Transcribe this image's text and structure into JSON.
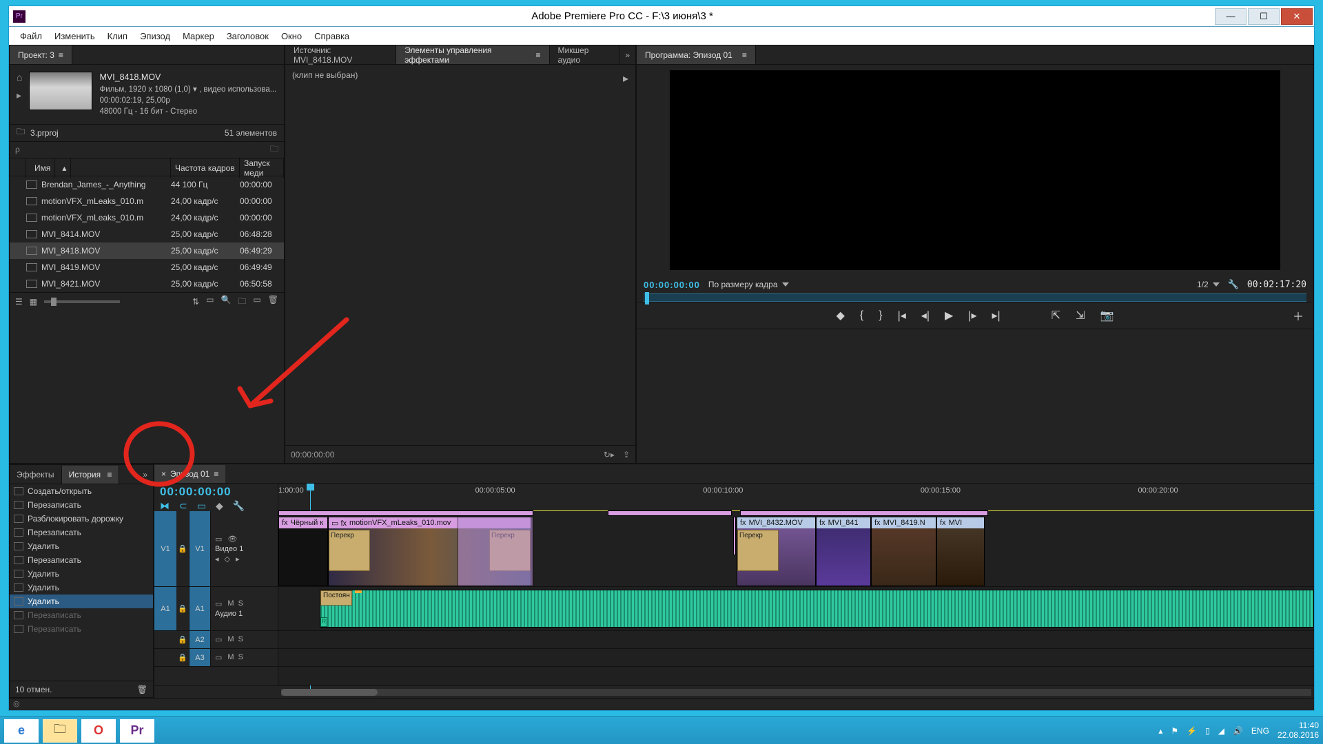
{
  "win": {
    "title": "Adobe Premiere Pro CC - F:\\3 июня\\3 *",
    "app_short": "Pr"
  },
  "menu": [
    "Файл",
    "Изменить",
    "Клип",
    "Эпизод",
    "Маркер",
    "Заголовок",
    "Окно",
    "Справка"
  ],
  "project": {
    "tab": "Проект: 3",
    "preview": {
      "name": "MVI_8418.MOV",
      "line1": "Фильм, 1920 x 1080 (1,0) ▾ , видео использова...",
      "line2": "00:00:02:19, 25,00p",
      "line3": "48000 Гц - 16 бит - Стерео"
    },
    "path": "3.prproj",
    "count": "51 элементов",
    "columns": {
      "name": "Имя",
      "fps": "Частота кадров",
      "start": "Запуск меди"
    },
    "assets": [
      {
        "color": "#2fae5d",
        "icon": "audio",
        "name": "Brendan_James_-_Anything",
        "fps": "44 100 Гц",
        "start": "00:00:00"
      },
      {
        "color": "#b78bd4",
        "icon": "video",
        "name": "motionVFX_mLeaks_010.m",
        "fps": "24,00 кадр/с",
        "start": "00:00:00"
      },
      {
        "color": "#b78bd4",
        "icon": "video",
        "name": "motionVFX_mLeaks_010.m",
        "fps": "24,00 кадр/с",
        "start": "00:00:00"
      },
      {
        "color": "#42a7d4",
        "icon": "video",
        "name": "MVI_8414.MOV",
        "fps": "25,00 кадр/с",
        "start": "06:48:28"
      },
      {
        "color": "#42a7d4",
        "icon": "video",
        "name": "MVI_8418.MOV",
        "fps": "25,00 кадр/с",
        "start": "06:49:29",
        "sel": true
      },
      {
        "color": "#42a7d4",
        "icon": "video",
        "name": "MVI_8419.MOV",
        "fps": "25,00 кадр/с",
        "start": "06:49:49"
      },
      {
        "color": "#42a7d4",
        "icon": "video",
        "name": "MVI_8421.MOV",
        "fps": "25,00 кадр/с",
        "start": "06:50:58"
      }
    ]
  },
  "mid": {
    "tabs": {
      "source": "Источник: MVI_8418.MOV",
      "fx": "Элементы управления эффектами",
      "mixer": "Микшер аудио"
    },
    "no_clip": "(клип не выбран)",
    "tc": "00:00:00:00"
  },
  "program": {
    "tab": "Программа: Эпизод 01",
    "tc_left": "00:00:00:00",
    "zoom": "По размеру кадра",
    "half": "1/2",
    "tc_right": "00:02:17:20"
  },
  "history": {
    "tabs": {
      "fx": "Эффекты",
      "hist": "История"
    },
    "items": [
      {
        "t": "Создать/открыть"
      },
      {
        "t": "Перезаписать"
      },
      {
        "t": "Разблокировать дорожку"
      },
      {
        "t": "Перезаписать"
      },
      {
        "t": "Удалить"
      },
      {
        "t": "Перезаписать"
      },
      {
        "t": "Удалить"
      },
      {
        "t": "Удалить"
      },
      {
        "t": "Удалить",
        "sel": true
      },
      {
        "t": "Перезаписать",
        "dim": true
      },
      {
        "t": "Перезаписать",
        "dim": true
      }
    ],
    "footer": "10 отмен."
  },
  "timeline": {
    "tab": "Эпизод 01",
    "tc": "00:00:00:00",
    "ticks": [
      {
        "l": "1:00:00",
        "p": 0
      },
      {
        "l": "00:00:05:00",
        "p": 19
      },
      {
        "l": "00:00:10:00",
        "p": 41
      },
      {
        "l": "00:00:15:00",
        "p": 62
      },
      {
        "l": "00:00:20:00",
        "p": 83
      }
    ],
    "tracks": {
      "v1_src": "V1",
      "v1_tgt": "V1",
      "v1_name": "Видео 1",
      "a1_src": "A1",
      "a1_tgt": "A1",
      "a1_name": "Аудио 1",
      "a2": "A2",
      "a3": "A3"
    },
    "clips": {
      "black": "Чёрный к",
      "motion": "motionVFX_mLeaks_010.mov",
      "trans": "Перекр",
      "c1": "MVI_8432.MOV",
      "c2": "MVI_841",
      "c3": "MVI_8419.N",
      "c4": "MVI",
      "audio_trans": "Постоян"
    }
  },
  "taskbar": {
    "lang": "ENG",
    "time": "11:40",
    "date": "22.08.2016"
  }
}
